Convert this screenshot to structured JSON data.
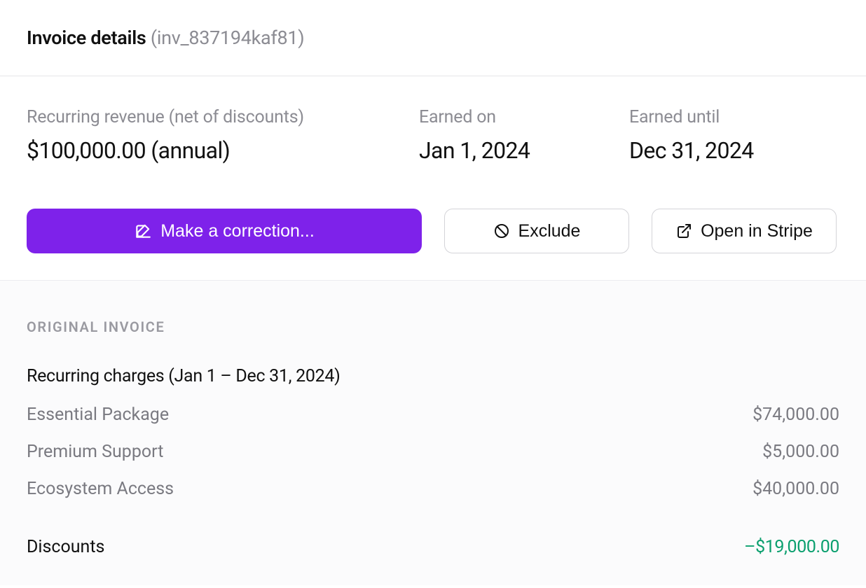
{
  "header": {
    "title": "Invoice details",
    "invoice_id": "(inv_837194kaf81)"
  },
  "summary": {
    "revenue": {
      "label": "Recurring revenue (net of discounts)",
      "value": "$100,000.00 (annual)"
    },
    "earned_on": {
      "label": "Earned on",
      "value": "Jan 1, 2024"
    },
    "earned_until": {
      "label": "Earned until",
      "value": "Dec 31, 2024"
    }
  },
  "actions": {
    "correction_label": "Make a correction...",
    "exclude_label": "Exclude",
    "open_stripe_label": "Open in Stripe"
  },
  "invoice": {
    "section_heading": "ORIGINAL INVOICE",
    "charges_heading": "Recurring charges (Jan 1 – Dec 31, 2024)",
    "line_items": [
      {
        "label": "Essential Package",
        "amount": "$74,000.00"
      },
      {
        "label": "Premium Support",
        "amount": "$5,000.00"
      },
      {
        "label": "Ecosystem Access",
        "amount": "$40,000.00"
      }
    ],
    "discounts": {
      "label": "Discounts",
      "amount": "–$19,000.00"
    }
  },
  "colors": {
    "accent": "#7e22ea",
    "positive": "#0a9f6e"
  }
}
